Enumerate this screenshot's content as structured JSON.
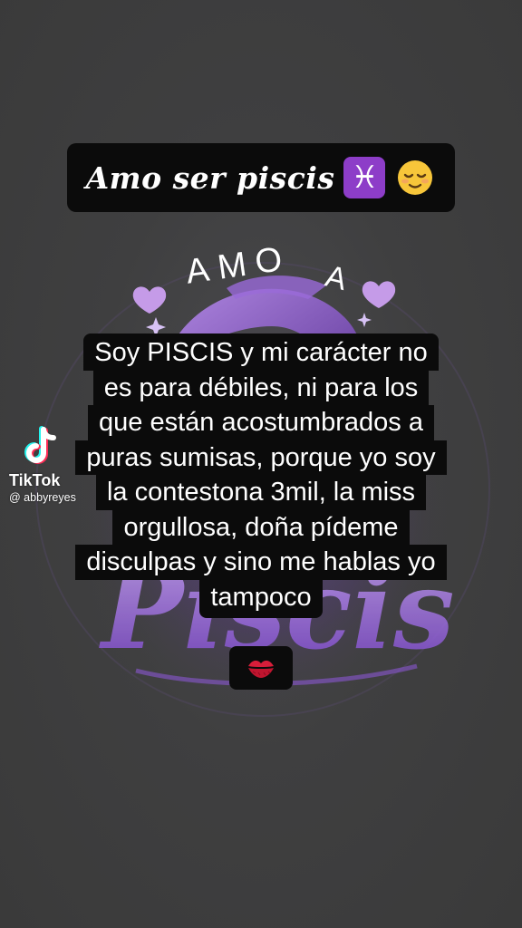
{
  "title": {
    "text": "Amo ser piscis",
    "zodiac_symbol": "♓",
    "emoji": "relieved-face-emoji"
  },
  "artwork": {
    "top_word": "AMO",
    "side_letter": "A",
    "script_word": "Piscis",
    "accent_color": "#8b4fd6",
    "icons": [
      "heart-icon",
      "heart-icon",
      "sparkle-icon",
      "sparkle-icon",
      "fish-icon"
    ]
  },
  "caption": {
    "lines": [
      "Soy PISCIS y mi carácter no",
      "es para débiles, ni para los",
      "que están acostumbrados a",
      "puras sumisas, porque yo soy",
      "la contestona 3mil, la miss",
      "orgullosa, doña pídeme",
      "disculpas y sino me hablas yo",
      "tampoco"
    ]
  },
  "kiss": {
    "emoji": "kiss-mark-emoji"
  },
  "watermark": {
    "brand": "TikTok",
    "username": "@ abbyreyes"
  }
}
